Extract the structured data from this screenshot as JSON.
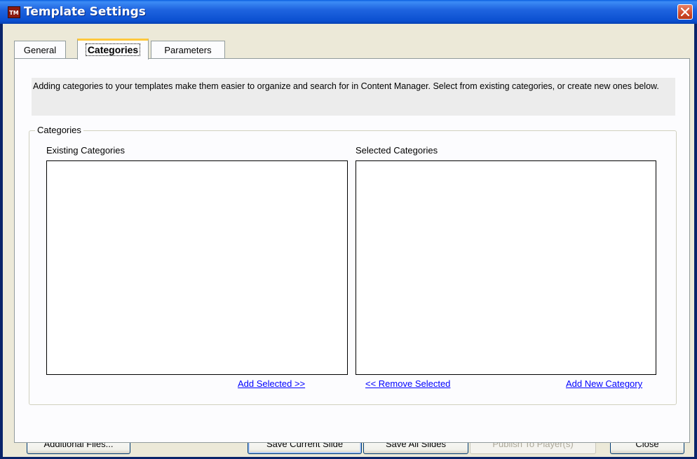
{
  "window": {
    "title": "Template Settings",
    "app_icon_text": "TM"
  },
  "tabs": [
    {
      "label": "General",
      "active": false
    },
    {
      "label": "Categories",
      "active": true
    },
    {
      "label": "Parameters",
      "active": false
    }
  ],
  "panel": {
    "description": "Adding categories to your templates make them easier to organize and search for in Content Manager. Select from existing categories, or create new ones below.",
    "group_label": "Categories",
    "existing": {
      "label": "Existing Categories",
      "items": []
    },
    "selected": {
      "label": "Selected Categories",
      "items": []
    },
    "links": {
      "add_selected": "Add Selected >>",
      "remove_selected": "<< Remove Selected",
      "add_new": "Add New Category"
    }
  },
  "footer": {
    "additional_files": "Additional Files...",
    "save_current": "Save Current Slide",
    "save_all": "Save All Slides",
    "publish": "Publish To Player(s)",
    "close": "Close"
  },
  "colors": {
    "titlebar": "#0A4FD0",
    "link": "#0000FF",
    "tab_highlight": "#FFC83C"
  }
}
